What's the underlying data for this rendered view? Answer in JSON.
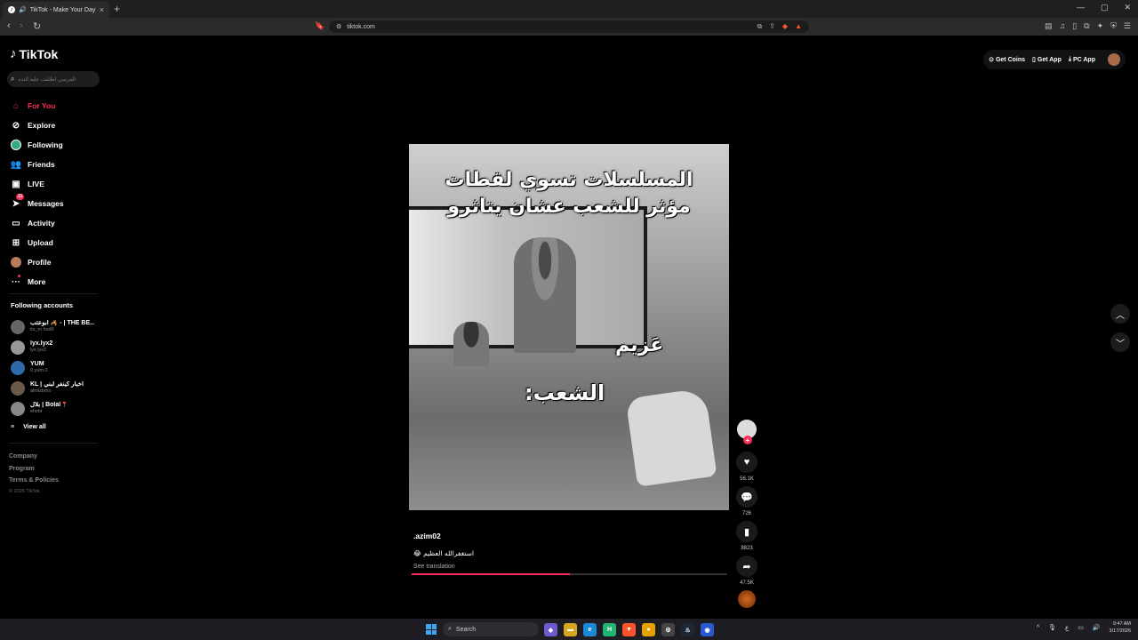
{
  "browser": {
    "tab_title": "TikTok - Make Your Day",
    "url": "tiktok.com",
    "new_tab": "+",
    "tab_close": "×"
  },
  "logo": "TikTok",
  "search": {
    "placeholder": "الفرسي اطلقت عليه النده"
  },
  "nav": {
    "for_you": "For You",
    "explore": "Explore",
    "following": "Following",
    "friends": "Friends",
    "live": "LIVE",
    "messages": "Messages",
    "messages_badge": "11",
    "activity": "Activity",
    "upload": "Upload",
    "profile": "Profile",
    "more": "More"
  },
  "following_accounts": {
    "title": "Following accounts",
    "items": [
      {
        "name": "ابوعتب 🦂 - | THE BE...",
        "username": "its_m.hsd0"
      },
      {
        "name": "lyx.lyx2",
        "username": "lyx.lyx2"
      },
      {
        "name": "YUM",
        "username": "0.yum.0"
      },
      {
        "name": "KL | أخبار كينفر لبني",
        "username": "almlzbmo"
      },
      {
        "name": "بلال | Bolal📍",
        "username": "ehzbr"
      }
    ],
    "view_all": "View all"
  },
  "footer": {
    "company": "Company",
    "program": "Program",
    "terms": "Terms & Policies",
    "copyright": "© 2026 TikTok"
  },
  "top_right": {
    "coins": "Get Coins",
    "app": "Get App",
    "pc_app": "PC App"
  },
  "video": {
    "caption_top": "المسلسلات تسوي لقطات مؤثر للشعب عشان يتاثرو",
    "caption_mid": "عَزيم",
    "caption_bottom": "الشعب:",
    "username": ".azim02",
    "description": "استغفرالله العظيم 😂",
    "see_translation": "See translation",
    "progress": 0.5
  },
  "actions": {
    "likes": "56.1K",
    "comments": "726",
    "saves": "8823",
    "shares": "47.5K"
  },
  "taskbar": {
    "search": "Search",
    "time": "9:47 AM",
    "date": "3/17/2026",
    "lang": "ع"
  }
}
